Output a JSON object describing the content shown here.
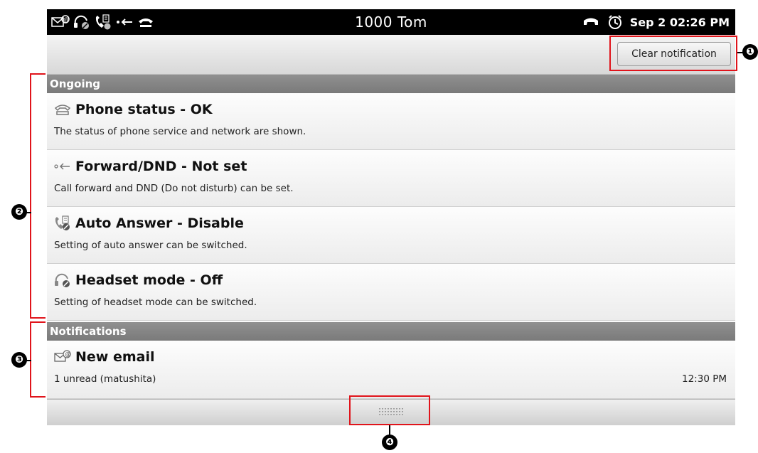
{
  "statusbar": {
    "title": "1000 Tom",
    "datetime": "Sep 2 02:26 PM",
    "left_icons": [
      "email-icon",
      "headset-off-icon",
      "auto-answer-icon",
      "forward-icon",
      "phone-icon"
    ],
    "right_icons": [
      "phone-handset-icon",
      "alarm-clock-icon"
    ]
  },
  "topbar": {
    "clear_label": "Clear notification"
  },
  "sections": {
    "ongoing": "Ongoing",
    "notifications": "Notifications"
  },
  "ongoing_items": [
    {
      "icon": "phone-status-icon",
      "title": "Phone status - OK",
      "desc": "The status of phone service and network are shown."
    },
    {
      "icon": "forward-dnd-icon",
      "title": "Forward/DND - Not set",
      "desc": "Call forward and DND (Do not disturb) can be set."
    },
    {
      "icon": "auto-answer-icon",
      "title": "Auto Answer - Disable",
      "desc": "Setting of auto answer can be switched."
    },
    {
      "icon": "headset-icon",
      "title": "Headset mode - Off",
      "desc": "Setting of headset mode can be switched."
    }
  ],
  "notification_items": [
    {
      "icon": "email-icon",
      "title": "New email",
      "desc": "1 unread (matushita)",
      "time": "12:30 PM"
    }
  ],
  "annotations": [
    "❶",
    "❷",
    "❸",
    "❹"
  ],
  "colors": {
    "callout": "#e0141b",
    "section_header": "#808080",
    "statusbar": "#000000"
  }
}
